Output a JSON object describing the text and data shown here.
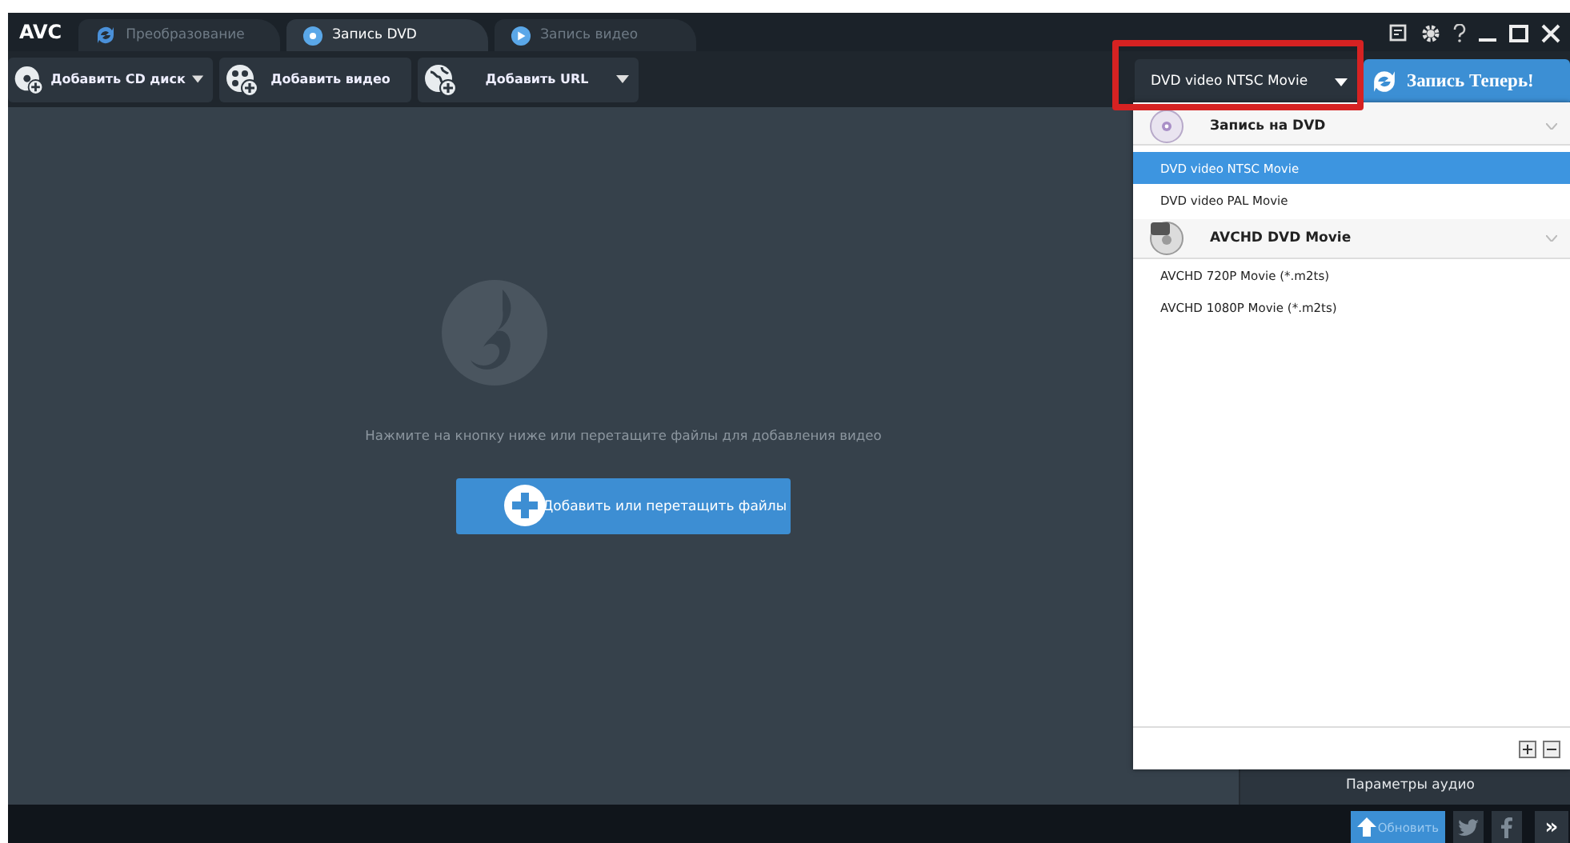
{
  "app": {
    "logo": "AVC"
  },
  "tabs": [
    {
      "label": "Преобразование",
      "selected": false
    },
    {
      "label": "Запись DVD",
      "selected": true
    },
    {
      "label": "Запись видео",
      "selected": false
    }
  ],
  "toolbar": [
    {
      "label": "Добавить CD диск",
      "has_menu": true
    },
    {
      "label": "Добавить видео",
      "has_menu": false
    },
    {
      "label": "Добавить URL",
      "has_menu": true
    }
  ],
  "profile_select": {
    "value": "DVD video NTSC Movie"
  },
  "burn_button": {
    "label": "Запись Теперь!"
  },
  "drop_area": {
    "hint": "Нажмите на кнопку ниже или перетащите файлы для добавления видео",
    "button": "Добавить или перетащить файлы"
  },
  "profile_menu": {
    "groups": [
      {
        "title": "Запись на DVD",
        "items": [
          {
            "label": "DVD video NTSC Movie",
            "selected": true
          },
          {
            "label": "DVD video PAL Movie",
            "selected": false
          }
        ]
      },
      {
        "title": "AVCHD DVD Movie",
        "items": [
          {
            "label": "AVCHD 720P Movie (*.m2ts)",
            "selected": false
          },
          {
            "label": "AVCHD 1080P Movie (*.m2ts)",
            "selected": false
          }
        ]
      }
    ]
  },
  "side_panel": {
    "items": [
      "Параметры аудио"
    ]
  },
  "status_bar": {
    "update_button": "Обновить",
    "more_button": "»"
  }
}
